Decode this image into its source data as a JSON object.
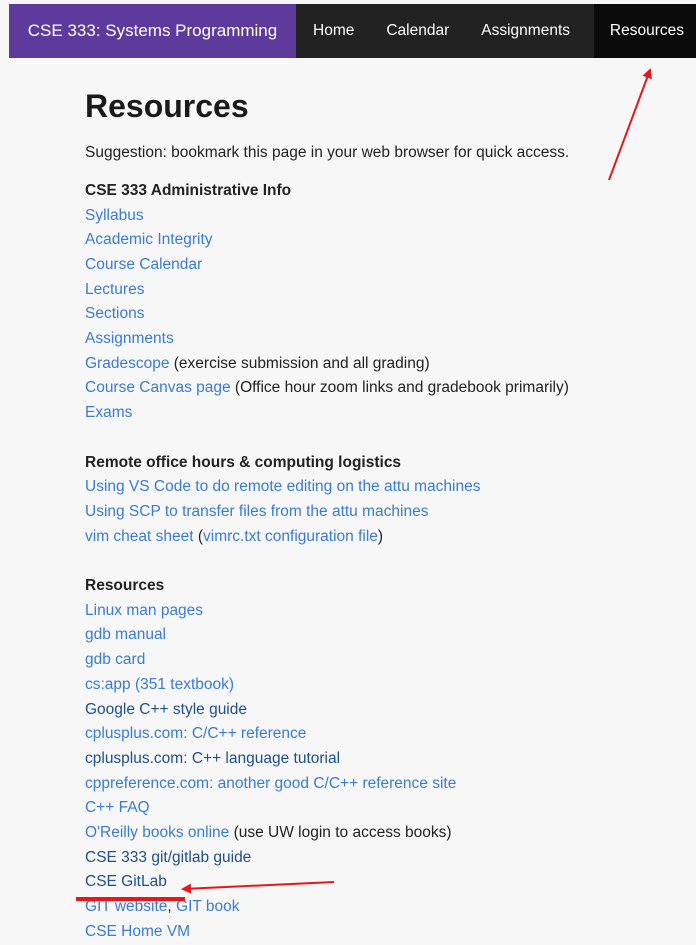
{
  "nav": {
    "brand": "CSE 333: Systems Programming",
    "items": [
      "Home",
      "Calendar",
      "Assignments",
      "Resources"
    ]
  },
  "page": {
    "title": "Resources",
    "suggestion": "Suggestion: bookmark this page in your web browser for quick access."
  },
  "admin": {
    "heading": "CSE 333 Administrative Info",
    "links": [
      "Syllabus",
      "Academic Integrity",
      "Course Calendar",
      "Lectures",
      "Sections",
      "Assignments"
    ],
    "gradescope": "Gradescope",
    "gradescope_note": " (exercise submission and all grading)",
    "canvas": "Course Canvas page",
    "canvas_note": " (Office hour zoom links and gradebook primarily)",
    "exams": "Exams"
  },
  "remote": {
    "heading": "Remote office hours & computing logistics",
    "vscode": "Using VS Code to do remote editing on the attu machines",
    "scp": "Using SCP to transfer files from the attu machines",
    "vim": "vim cheat sheet",
    "vim_paren_open": " (",
    "vimrc": "vimrc.txt configuration file",
    "vim_paren_close": ")"
  },
  "resources": {
    "heading": "Resources",
    "man": "Linux man pages",
    "gdb_manual": "gdb manual",
    "gdb_card": "gdb card",
    "csapp": "cs:app (351 textbook)",
    "google_style": "Google C++ style guide",
    "cplusplus_ref": "cplusplus.com: C/C++ reference",
    "cplusplus_tut": "cplusplus.com: C++ language tutorial",
    "cppreference": "cppreference.com: another good C/C++ reference site",
    "cppfaq": "C++ FAQ",
    "oreilly": "O'Reilly books online",
    "oreilly_note": " (use UW login to access books)",
    "gitguide": "CSE 333 git/gitlab guide",
    "gitlab": "CSE GitLab",
    "git_website": "GIT website",
    "comma": ", ",
    "git_book": "GIT book",
    "homevm": "CSE Home VM"
  },
  "colors": {
    "brand": "#5d3a9b",
    "navbar": "#222222",
    "link": "#3a7bd5",
    "annotation": "#e8161b"
  }
}
